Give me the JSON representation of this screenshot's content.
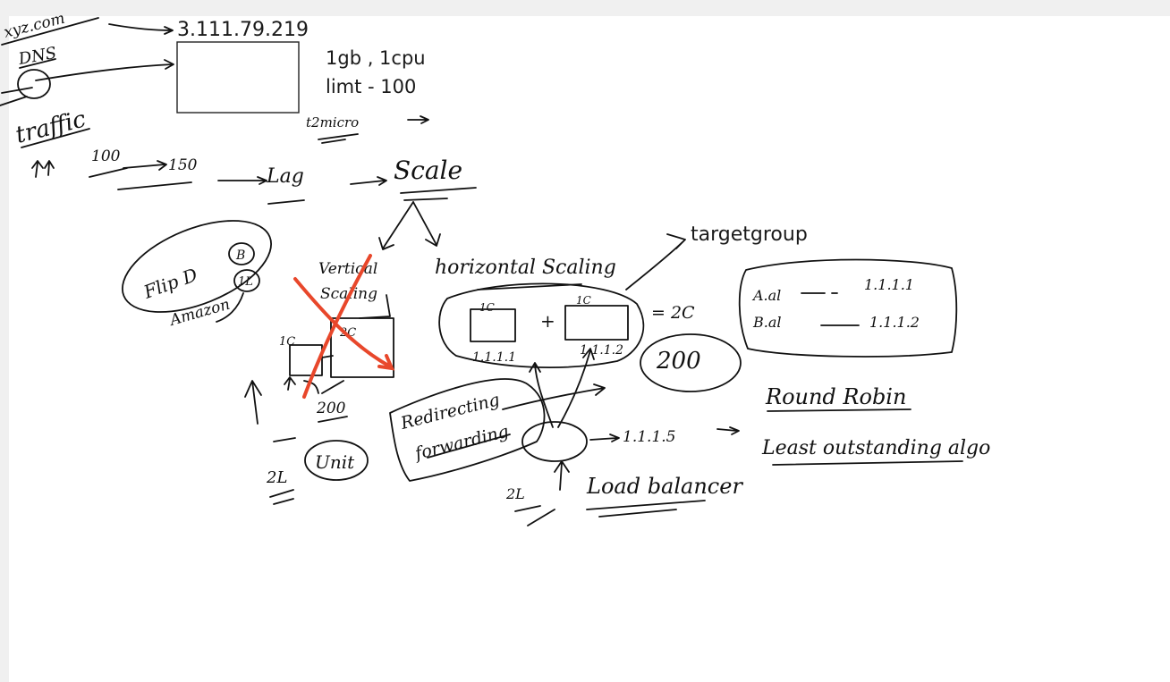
{
  "typed": {
    "ip": "3.111.79.219",
    "spec_line1": "1gb , 1cpu",
    "spec_line2": "limt - 100",
    "targetgroup": "targetgroup"
  },
  "handwritten": {
    "domain": "xyz.com",
    "dns": "DNS",
    "traffic": "traffic",
    "t2micro": "t2micro",
    "n100": "100",
    "n150": "150",
    "lag": "Lag",
    "scale": "Scale",
    "flipkart": "Flip D",
    "amazon": "Amazon",
    "circle_b": "B",
    "circle_1l": "1L",
    "vertical": "Vertical",
    "scaling": "Scaling",
    "c1": "1C",
    "c2": "2C",
    "n200_small": "200",
    "twenty_l": "2L",
    "unit": "Unit",
    "horizontal": "horizontal Scaling",
    "eq2c": "= 2C",
    "n200": "200",
    "ip_a": "1.1.1.1",
    "ip_b": "1.1.1.2",
    "row_a": "A.al",
    "row_b": "B.al",
    "map_a": "1.1.1.1",
    "map_b": "1.1.1.2",
    "redirecting": "Redirecting",
    "forwarding": "forwarding",
    "lb_ip": "1.1.1.5",
    "lb_label": "Load balancer",
    "round_robin": "Round Robin",
    "least": "Least outstanding algo",
    "two_l": "2L"
  }
}
